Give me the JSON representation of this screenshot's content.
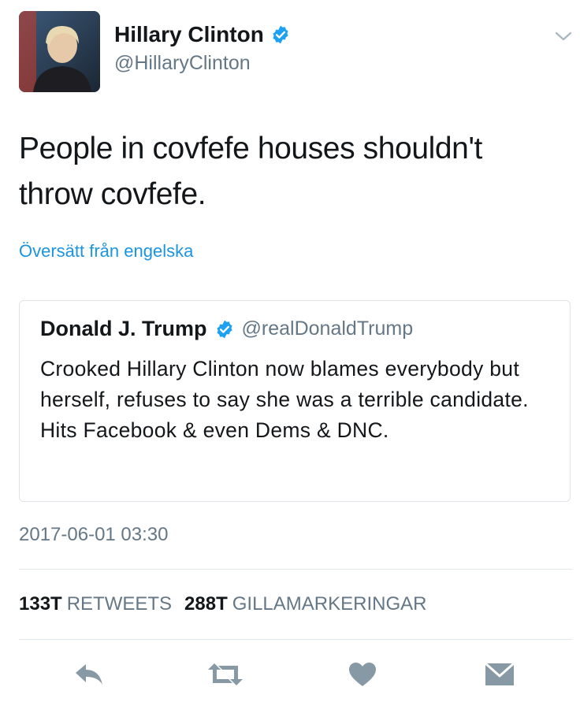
{
  "tweet": {
    "author": {
      "name": "Hillary Clinton",
      "handle": "@HillaryClinton",
      "verified": true
    },
    "text": "People in covfefe houses shouldn't throw covfefe.",
    "translate_link": "Översätt från engelska",
    "quoted_tweet": {
      "author_name": "Donald J. Trump",
      "handle": "@realDonaldTrump",
      "verified": true,
      "text": "Crooked Hillary Clinton now blames everybody but herself, refuses to say she was a terrible candidate. Hits Facebook & even Dems & DNC."
    },
    "timestamp": "2017-06-01 03:30",
    "stats": {
      "retweets_count": "133T",
      "retweets_label": "RETWEETS",
      "likes_count": "288T",
      "likes_label": "GILLAMARKERINGAR"
    },
    "actions": [
      "reply-icon",
      "retweet-icon",
      "like-icon",
      "direct-message-icon"
    ]
  },
  "colors": {
    "link": "#1b95e0",
    "verified": "#1da1f2",
    "secondary_text": "#657786",
    "icon": "#8899a6",
    "divider": "#e1e8ed"
  }
}
